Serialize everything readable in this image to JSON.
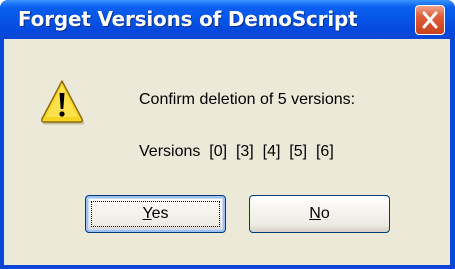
{
  "window": {
    "title": "Forget Versions of DemoScript",
    "close_icon": "close-icon"
  },
  "message": {
    "icon": "warning-icon",
    "line1": "Confirm deletion of 5 versions:",
    "line2": "Versions  [0]  [3]  [4]  [5]  [6]"
  },
  "buttons": {
    "yes_mnemonic": "Y",
    "yes_rest": "es",
    "no_mnemonic": "N",
    "no_rest": "o"
  },
  "colors": {
    "titlebar": "#0654e6",
    "client_bg": "#ece9d8",
    "close_button": "#d64b27",
    "warning_fill": "#f7d51f"
  }
}
